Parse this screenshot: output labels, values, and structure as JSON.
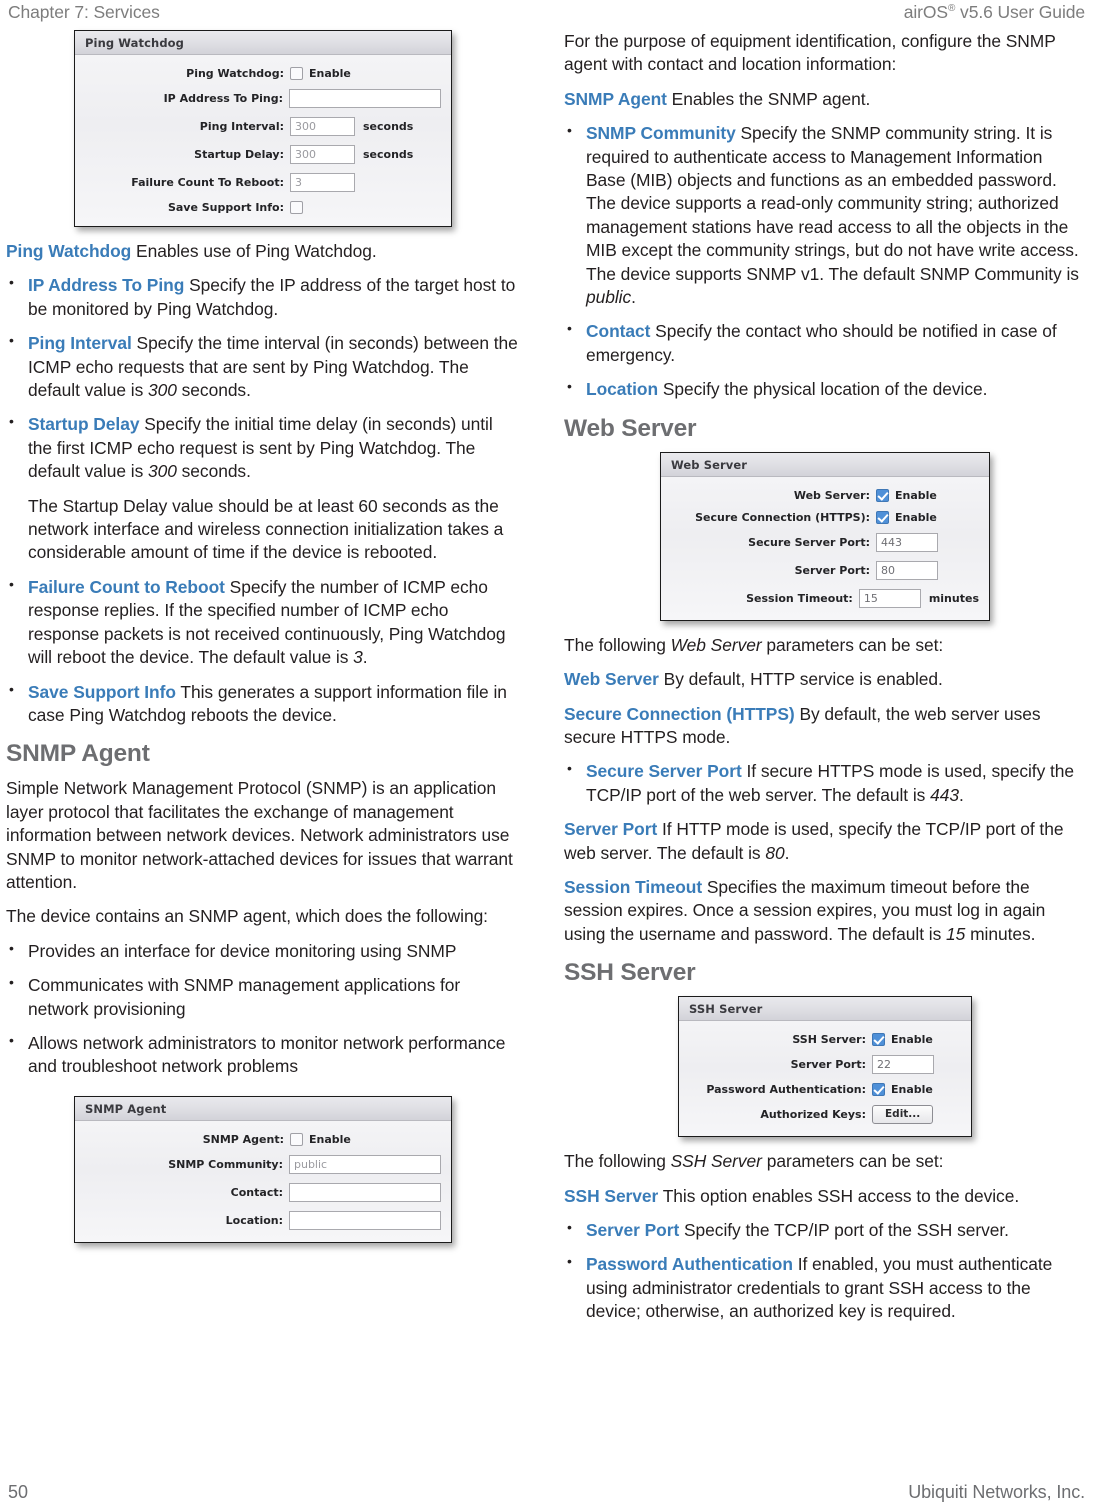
{
  "header": {
    "chapter": "Chapter 7: Services",
    "guide_pre": "airOS",
    "guide_sup": "®",
    "guide_post": " v5.6 User Guide"
  },
  "footer": {
    "page_number": "50",
    "brand": "Ubiquiti Networks, Inc."
  },
  "colors": {
    "heading_blue": "#3a7cb8",
    "section_gray": "#6d6e71",
    "body_black": "#231f20",
    "checkbox_blue": "#4f90d8"
  },
  "screens": {
    "ping_watchdog": {
      "title": "Ping Watchdog",
      "rows": [
        {
          "label": "Ping Watchdog:",
          "type": "checkbox",
          "checked": false,
          "cb_label": "Enable"
        },
        {
          "label": "IP Address To Ping:",
          "type": "text",
          "value": "",
          "unit": ""
        },
        {
          "label": "Ping Interval:",
          "type": "text",
          "value": "300",
          "unit": "seconds"
        },
        {
          "label": "Startup Delay:",
          "type": "text",
          "value": "300",
          "unit": "seconds"
        },
        {
          "label": "Failure Count To Reboot:",
          "type": "text",
          "value": "3",
          "unit": ""
        },
        {
          "label": "Save Support Info:",
          "type": "checkbox",
          "checked": false,
          "cb_label": ""
        }
      ]
    },
    "snmp_agent": {
      "title": "SNMP Agent",
      "rows": [
        {
          "label": "SNMP Agent:",
          "type": "checkbox",
          "checked": false,
          "cb_label": "Enable"
        },
        {
          "label": "SNMP Community:",
          "type": "text",
          "value": "public",
          "unit": ""
        },
        {
          "label": "Contact:",
          "type": "text",
          "value": "",
          "unit": ""
        },
        {
          "label": "Location:",
          "type": "text",
          "value": "",
          "unit": ""
        }
      ]
    },
    "web_server": {
      "title": "Web Server",
      "rows": [
        {
          "label": "Web Server:",
          "type": "checkbox",
          "checked": true,
          "cb_label": "Enable"
        },
        {
          "label": "Secure Connection (HTTPS):",
          "type": "checkbox",
          "checked": true,
          "cb_label": "Enable"
        },
        {
          "label": "Secure Server Port:",
          "type": "text",
          "value": "443",
          "unit": ""
        },
        {
          "label": "Server Port:",
          "type": "text",
          "value": "80",
          "unit": ""
        },
        {
          "label": "Session Timeout:",
          "type": "text",
          "value": "15",
          "unit": "minutes"
        }
      ]
    },
    "ssh_server": {
      "title": "SSH Server",
      "rows": [
        {
          "label": "SSH Server:",
          "type": "checkbox",
          "checked": true,
          "cb_label": "Enable"
        },
        {
          "label": "Server Port:",
          "type": "text",
          "value": "22",
          "unit": ""
        },
        {
          "label": "Password Authentication:",
          "type": "checkbox",
          "checked": true,
          "cb_label": "Enable"
        },
        {
          "label": "Authorized Keys:",
          "type": "button",
          "value": "Edit...",
          "unit": ""
        }
      ]
    }
  },
  "left_column": {
    "ping_watchdog_lead": "Ping Watchdog",
    "ping_watchdog_body": "  Enables use of Ping Watchdog.",
    "bullets": [
      {
        "lead": "IP Address To Ping",
        "body": "  Specify the IP address of the target host to be monitored by Ping Watchdog."
      },
      {
        "lead": "Ping Interval",
        "body_a": "  Specify the time interval (in seconds) between the ICMP echo requests that are sent by Ping Watchdog. The default value is ",
        "italic": "300",
        "body_b": " seconds."
      },
      {
        "lead": "Startup Delay",
        "body_a": "  Specify the initial time delay (in seconds) until the first ICMP echo request is sent by Ping Watchdog. The default value is ",
        "italic": "300",
        "body_b": " seconds."
      }
    ],
    "startup_note": "The Startup Delay value should be at least 60 seconds as the network interface and wireless connection initialization takes a considerable amount of time if the device is rebooted.",
    "failure_count": {
      "lead": "Failure Count to Reboot",
      "body_a": "  Specify the number of ICMP echo response replies. If the specified number of ICMP echo response packets is not received continuously, Ping Watchdog will reboot the device. The default value is ",
      "italic": "3",
      "body_b": "."
    },
    "save_support": {
      "lead": "Save Support Info",
      "body": "  This generates a support information file in case Ping Watchdog reboots the device."
    },
    "snmp_heading": "SNMP Agent",
    "snmp_para1": "Simple Network Management Protocol (SNMP) is an application layer protocol that facilitates the exchange of management information between network devices. Network administrators use SNMP to monitor network-attached devices for issues that warrant attention.",
    "snmp_para2": "The device contains an SNMP agent, which does the following:",
    "snmp_bullets": [
      "Provides an interface for device monitoring using SNMP",
      "Communicates with SNMP management applications for network provisioning",
      "Allows network administrators to monitor network performance and troubleshoot network problems"
    ]
  },
  "right_column": {
    "intro": "For the purpose of equipment identification, configure the SNMP agent with contact and location information:",
    "snmp_agent": {
      "lead": "SNMP Agent",
      "body": "  Enables the SNMP agent."
    },
    "snmp_bullets": [
      {
        "lead": "SNMP Community",
        "body_a": "  Specify the SNMP community string. It is required to authenticate access to Management Information Base (MIB) objects and functions as an embedded password. The device supports a read-only community string; authorized management stations have read access to all the objects in the MIB except the community strings, but do not have write access. The device supports SNMP v1. The default SNMP Community is ",
        "italic": "public",
        "body_b": "."
      },
      {
        "lead": "Contact",
        "body": "  Specify the contact who should be notified in case of emergency."
      },
      {
        "lead": "Location",
        "body": "  Specify the physical location of the device."
      }
    ],
    "web_server_heading": "Web Server",
    "web_following_a": "The following ",
    "web_following_it": "Web Server",
    "web_following_b": " parameters can be set:",
    "web_server_lead": "Web Server",
    "web_server_body": "  By default, HTTP service is enabled.",
    "secure_conn_lead": "Secure Connection (HTTPS)",
    "secure_conn_body": "  By default, the web server uses secure HTTPS mode.",
    "secure_port": {
      "lead": "Secure Server Port",
      "body_a": "  If secure HTTPS mode is used, specify the TCP/IP port of the web server. The default is ",
      "italic": "443",
      "body_b": "."
    },
    "server_port": {
      "lead": "Server Port",
      "body_a": "  If HTTP mode is used, specify the TCP/IP port of the web server. The default is ",
      "italic": "80",
      "body_b": "."
    },
    "session_timeout": {
      "lead": "Session Timeout",
      "body_a": "  Specifies the maximum timeout before the session expires. Once a session expires, you must log in again using the username and password. The default is ",
      "italic": "15",
      "body_b": " minutes."
    },
    "ssh_server_heading": "SSH Server",
    "ssh_following_a": "The following ",
    "ssh_following_it": "SSH Server",
    "ssh_following_b": " parameters can be set:",
    "ssh_server_lead": "SSH Server",
    "ssh_server_body": "  This option enables SSH access to the device.",
    "ssh_bullets": [
      {
        "lead": "Server Port",
        "body": "  Specify the TCP/IP port of the SSH server."
      },
      {
        "lead": "Password Authentication",
        "body": "  If enabled, you must authenticate using administrator credentials to grant SSH access to the device; otherwise, an authorized key is required."
      }
    ]
  }
}
